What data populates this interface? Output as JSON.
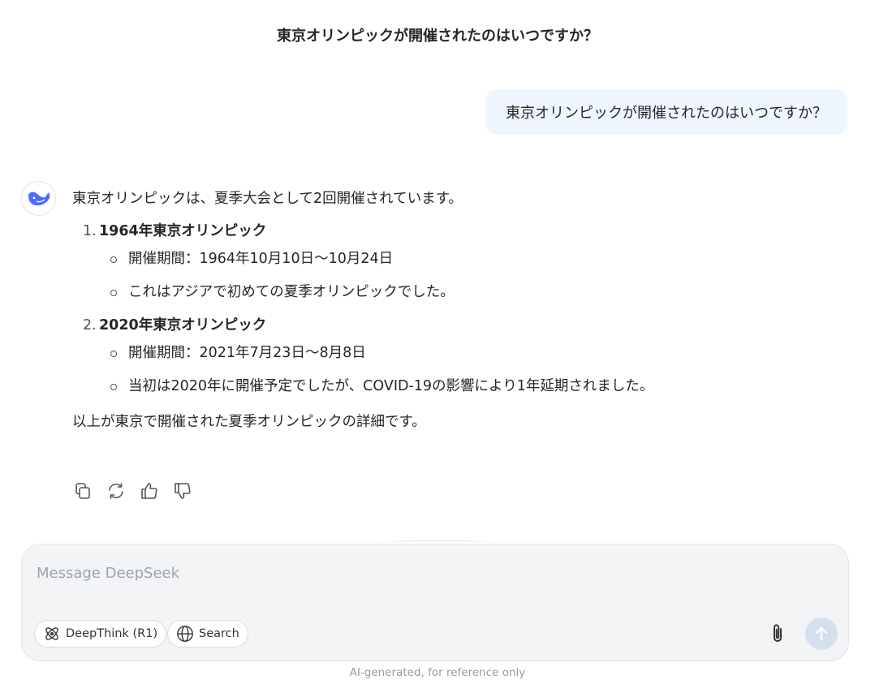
{
  "header": {
    "title": "東京オリンピックが開催されたのはいつですか？"
  },
  "user_message": {
    "text": "東京オリンピックが開催されたのはいつですか？"
  },
  "assistant": {
    "intro": "東京オリンピックは、夏季大会として2回開催されています。",
    "items": [
      {
        "number": "1.",
        "heading": "1964年東京オリンピック",
        "bullets": [
          "開催期間：1964年10月10日～10月24日",
          "これはアジアで初めての夏季オリンピックでした。"
        ]
      },
      {
        "number": "2.",
        "heading": "2020年東京オリンピック",
        "bullets": [
          "開催期間：2021年7月23日～8月8日",
          "当初は2020年に開催予定でしたが、COVID-19の影響により1年延期されました。"
        ]
      }
    ],
    "outro": "以上が東京で開催された夏季オリンピックの詳細です。"
  },
  "actions": [
    "copy-icon",
    "regenerate-icon",
    "thumbs-up-icon",
    "thumbs-down-icon"
  ],
  "composer": {
    "placeholder": "Message DeepSeek",
    "deepthink_label": "DeepThink (R1)",
    "search_label": "Search"
  },
  "footer": {
    "disclaimer": "AI-generated, for reference only"
  },
  "colors": {
    "accent": "#4d6bfe",
    "user_bubble": "#eff6ff",
    "send_disabled": "#d6dff0"
  }
}
